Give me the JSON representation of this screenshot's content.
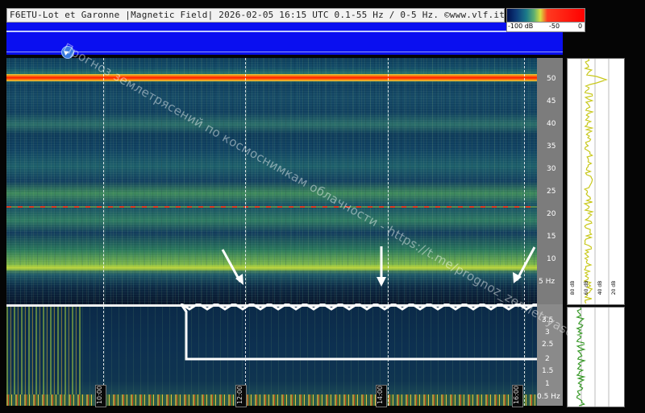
{
  "header": {
    "title": "F6ETU-Lot et Garonne |Magnetic Field| 2026-02-05 16:15 UTC 0.1-55 Hz / 0-5 Hz. ©www.vlf.it"
  },
  "colorbar": {
    "labels": [
      "-100 dB",
      "-50",
      "0"
    ],
    "colors": [
      "#001050",
      "#1b7a8a",
      "#d8e040",
      "#ff0000"
    ]
  },
  "freq_axis_top": [
    "50",
    "45",
    "40",
    "35",
    "30",
    "25",
    "20",
    "15",
    "10",
    "5 Hz"
  ],
  "freq_axis_bottom": [
    "3.5",
    "3",
    "2.5",
    "2",
    "1.5",
    "1",
    "0.5 Hz"
  ],
  "time_labels": [
    "10:00",
    "12:00",
    "14:00",
    "16:00"
  ],
  "side_plot_ticks": [
    "80 dB",
    "60 dB",
    "40 dB",
    "20 dB"
  ],
  "watermark": "Прогноз землетрясений по космоснимкам облачности - https://t.me/prognoz_zemletryaseniy",
  "accent_colors": {
    "band_50hz": "#ff1a00",
    "header_band": "#0a0ff0",
    "arrows": "#ffffff"
  }
}
